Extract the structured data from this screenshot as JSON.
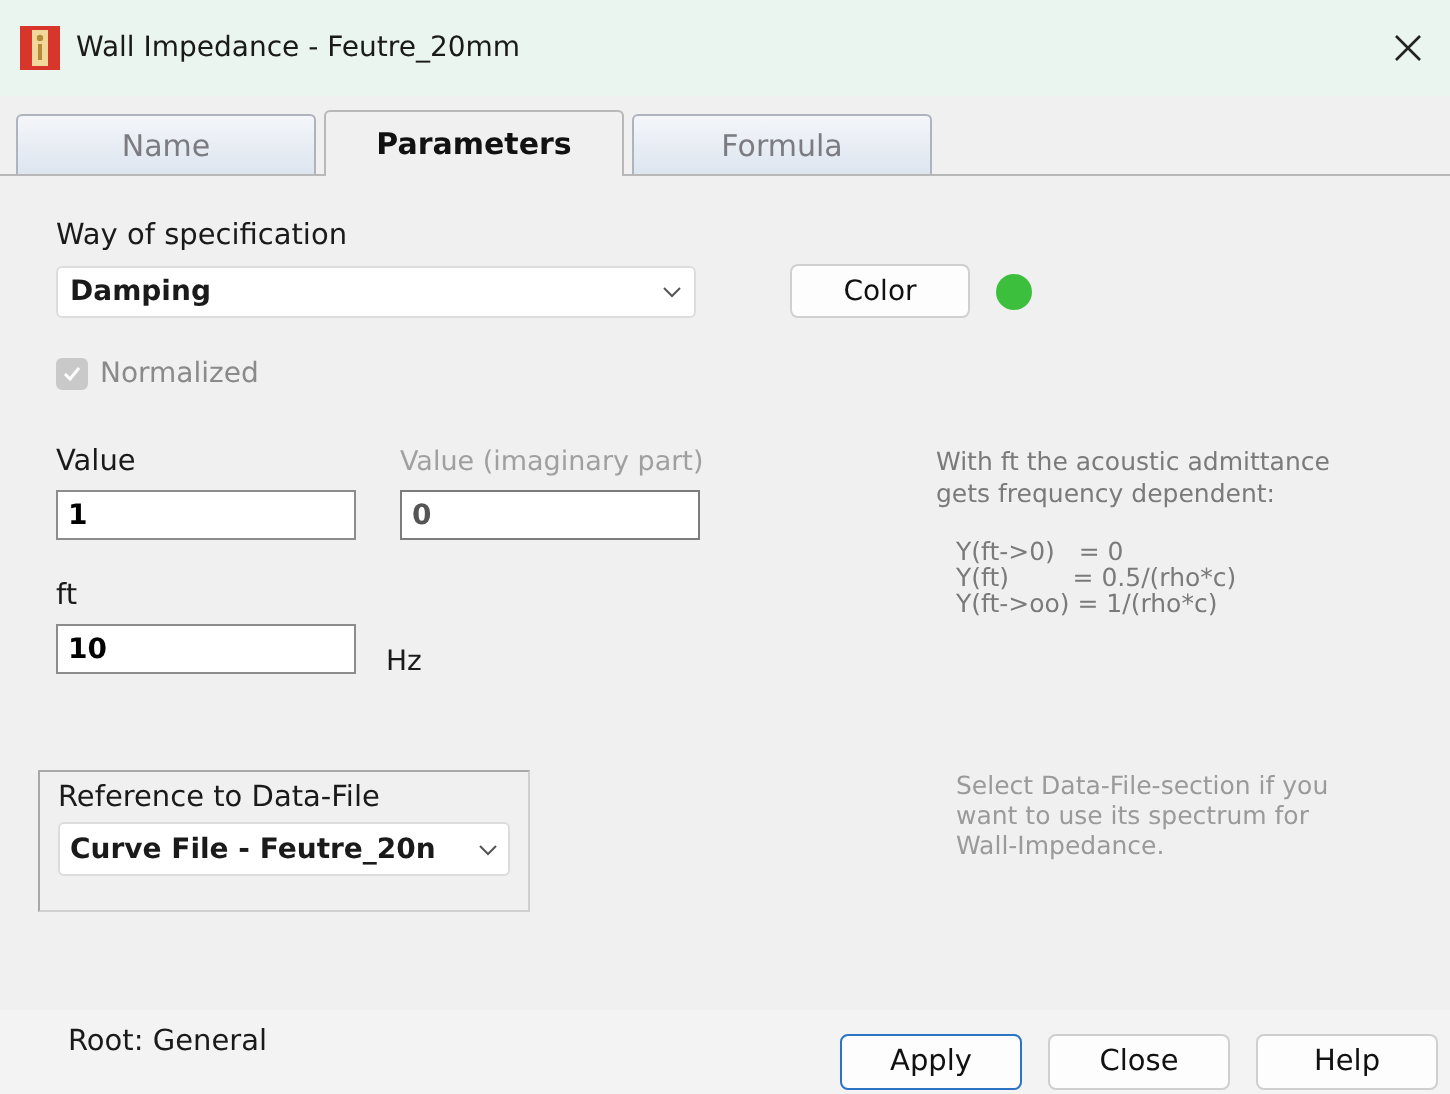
{
  "window": {
    "title": "Wall Impedance - Feutre_20mm"
  },
  "tabs": [
    {
      "label": "Name",
      "selected": false
    },
    {
      "label": "Parameters",
      "selected": true
    },
    {
      "label": "Formula",
      "selected": false
    }
  ],
  "specification": {
    "label": "Way of specification",
    "value": "Damping",
    "color_button": "Color",
    "color": "#3cbf3c"
  },
  "normalized": {
    "label": "Normalized",
    "checked": true,
    "disabled": true
  },
  "value": {
    "label": "Value",
    "value": "1",
    "disabled": false
  },
  "imaginary": {
    "label": "Value (imaginary part)",
    "value": "0",
    "disabled": true
  },
  "ft": {
    "label": "ft",
    "value": "10",
    "unit": "Hz"
  },
  "help_text": {
    "intro": [
      "With ft the acoustic admittance",
      "gets frequency dependent:"
    ],
    "formulas": [
      "Y(ft->0)   = 0",
      "Y(ft)        = 0.5/(rho*c)",
      "Y(ft->oo) = 1/(rho*c)"
    ]
  },
  "reference": {
    "label": "Reference to Data-File",
    "value": "Curve File - Feutre_20n"
  },
  "reference_hint": [
    "Select Data-File-section if you",
    "want to use its spectrum for",
    "Wall-Impedance."
  ],
  "status_bar": {
    "root": "Root: General"
  },
  "buttons": [
    {
      "label": "Apply",
      "default": true
    },
    {
      "label": "Close",
      "default": false
    },
    {
      "label": "Help",
      "default": false
    }
  ]
}
